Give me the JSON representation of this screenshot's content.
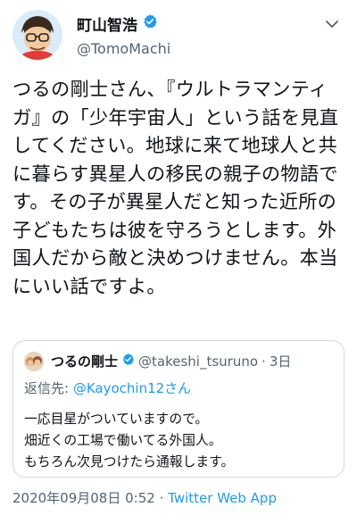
{
  "author": {
    "display_name": "町山智浩",
    "handle": "@TomoMachi"
  },
  "tweet": {
    "text": "つるの剛士さん、『ウルトラマンティガ』の「少年宇宙人」という話を見直してください。地球に来て地球人と共に暮らす異星人の移民の親子の物語です。その子が異星人だと知った近所の子どもたちは彼を守ろうとします。外国人だから敵と決めつけません。本当にいい話ですよ。"
  },
  "quoted": {
    "display_name": "つるの剛士",
    "handle": "@takeshi_tsuruno",
    "separator": "·",
    "time": "3日",
    "reply_prefix": "返信先: ",
    "reply_to": "@Kayochin12さん",
    "lines": [
      "一応目星がついていますので。",
      "畑近くの工場で働いてる外国人。",
      "もちろん次見つけたら通報します。"
    ]
  },
  "meta": {
    "timestamp": "2020年09月08日 0:52",
    "separator": "·",
    "source": "Twitter Web App"
  },
  "colors": {
    "verified": "#1d9bf0",
    "link": "#1d9bf0",
    "muted": "#536471"
  },
  "icons": {
    "verified": "verified-badge-icon",
    "menu": "chevron-down-icon"
  }
}
